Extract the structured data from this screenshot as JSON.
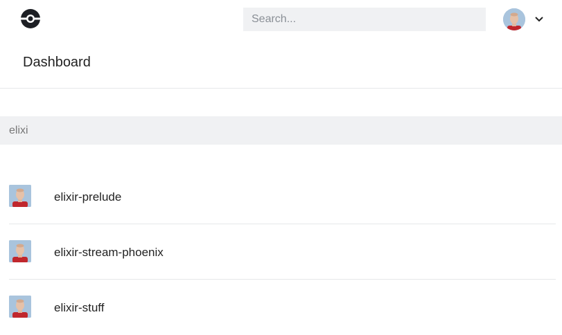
{
  "header": {
    "logo": "logo-icon",
    "search": {
      "placeholder": "Search...",
      "value": ""
    },
    "user": {
      "avatar": "user-avatar",
      "menu_icon": "chevron-down-icon"
    }
  },
  "page": {
    "title": "Dashboard"
  },
  "filter": {
    "value": "elixi"
  },
  "repos": [
    {
      "name": "elixir-prelude"
    },
    {
      "name": "elixir-stream-phoenix"
    },
    {
      "name": "elixir-stuff"
    }
  ]
}
